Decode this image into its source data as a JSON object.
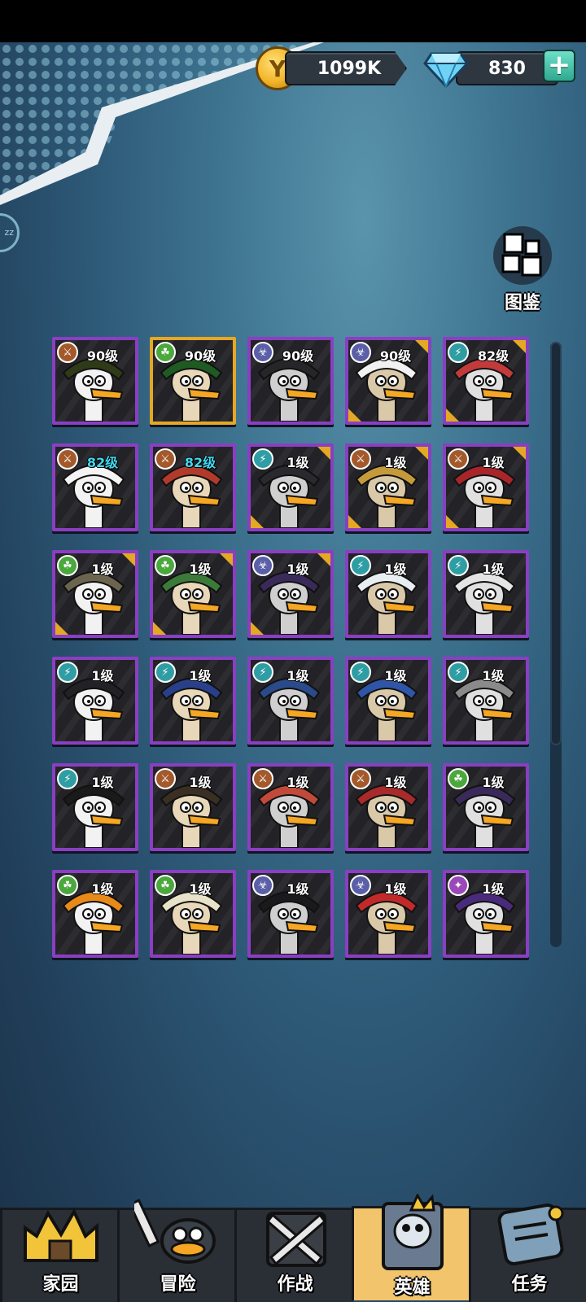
{
  "resources": {
    "coins": "1099K",
    "gems": "830",
    "add_label": "+"
  },
  "codex": {
    "label": "图鉴"
  },
  "heroes": [
    {
      "level": "90级",
      "class": "warrior",
      "frame": "purple",
      "level_color": "white",
      "portrait": "dreadlock-goose"
    },
    {
      "level": "90级",
      "class": "nature",
      "frame": "gold",
      "level_color": "white",
      "portrait": "spiky-green-goose"
    },
    {
      "level": "90级",
      "class": "toxic",
      "frame": "purple",
      "level_color": "white",
      "portrait": "dark-dragon-goose"
    },
    {
      "level": "90级",
      "class": "toxic",
      "frame": "gold-corner",
      "level_color": "white",
      "portrait": "white-hair-goose"
    },
    {
      "level": "82级",
      "class": "tech",
      "frame": "gold-corner",
      "level_color": "white",
      "portrait": "red-cap-goose"
    },
    {
      "level": "82级",
      "class": "warrior",
      "frame": "purple",
      "level_color": "cyan",
      "portrait": "witch-hat-goose"
    },
    {
      "level": "82级",
      "class": "warrior",
      "frame": "purple",
      "level_color": "cyan",
      "portrait": "samurai-goose"
    },
    {
      "level": "1级",
      "class": "tech",
      "frame": "gold-corner",
      "level_color": "white",
      "portrait": "suit-goose"
    },
    {
      "level": "1级",
      "class": "warrior",
      "frame": "gold-corner",
      "level_color": "white",
      "portrait": "gladiator-goose"
    },
    {
      "level": "1级",
      "class": "warrior",
      "frame": "gold-corner",
      "level_color": "white",
      "portrait": "red-hair-goose"
    },
    {
      "level": "1级",
      "class": "nature",
      "frame": "gold-corner",
      "level_color": "white",
      "portrait": "viking-goose"
    },
    {
      "level": "1级",
      "class": "nature",
      "frame": "gold-corner",
      "level_color": "white",
      "portrait": "army-helmet-goose"
    },
    {
      "level": "1级",
      "class": "toxic",
      "frame": "gold-corner",
      "level_color": "white",
      "portrait": "shadow-goose"
    },
    {
      "level": "1级",
      "class": "tech",
      "frame": "purple",
      "level_color": "white",
      "portrait": "mech-goose"
    },
    {
      "level": "1级",
      "class": "tech",
      "frame": "purple",
      "level_color": "white",
      "portrait": "goggles-goose"
    },
    {
      "level": "1级",
      "class": "tech",
      "frame": "purple",
      "level_color": "white",
      "portrait": "plain-goose"
    },
    {
      "level": "1级",
      "class": "tech",
      "frame": "purple",
      "level_color": "white",
      "portrait": "robot-goose"
    },
    {
      "level": "1级",
      "class": "tech",
      "frame": "purple",
      "level_color": "white",
      "portrait": "blue-helmet-goose"
    },
    {
      "level": "1级",
      "class": "tech",
      "frame": "purple",
      "level_color": "white",
      "portrait": "football-goose"
    },
    {
      "level": "1级",
      "class": "tech",
      "frame": "purple",
      "level_color": "white",
      "portrait": "glasses-goose"
    },
    {
      "level": "1级",
      "class": "tech",
      "frame": "purple",
      "level_color": "white",
      "portrait": "black-hair-goose"
    },
    {
      "level": "1级",
      "class": "warrior",
      "frame": "purple",
      "level_color": "white",
      "portrait": "straw-hat-goose"
    },
    {
      "level": "1级",
      "class": "warrior",
      "frame": "purple",
      "level_color": "white",
      "portrait": "fox-hood-goose"
    },
    {
      "level": "1级",
      "class": "warrior",
      "frame": "purple",
      "level_color": "white",
      "portrait": "red-mane-goose"
    },
    {
      "level": "1级",
      "class": "nature",
      "frame": "purple",
      "level_color": "white",
      "portrait": "pirate-goose"
    },
    {
      "level": "1级",
      "class": "nature",
      "frame": "purple",
      "level_color": "white",
      "portrait": "flame-hair-goose"
    },
    {
      "level": "1级",
      "class": "nature",
      "frame": "purple",
      "level_color": "white",
      "portrait": "turban-goose"
    },
    {
      "level": "1级",
      "class": "toxic",
      "frame": "purple",
      "level_color": "white",
      "portrait": "black-blob-goose"
    },
    {
      "level": "1级",
      "class": "toxic",
      "frame": "purple",
      "level_color": "white",
      "portrait": "red-mask-goose"
    },
    {
      "level": "1级",
      "class": "arcane",
      "frame": "purple",
      "level_color": "white",
      "portrait": "void-goose"
    }
  ],
  "nav": [
    {
      "label": "家园",
      "icon": "castle-icon",
      "active": false
    },
    {
      "label": "冒险",
      "icon": "sword-duck-icon",
      "active": false
    },
    {
      "label": "作战",
      "icon": "crossed-swords-icon",
      "active": false
    },
    {
      "label": "英雄",
      "icon": "hero-book-icon",
      "active": true
    },
    {
      "label": "任务",
      "icon": "scroll-icon",
      "active": false
    }
  ],
  "colors": {
    "frame_purple": "#8a3fc2",
    "frame_gold": "#e4a824",
    "level_cyan": "#43d8f0",
    "nav_active": "#f2c46b"
  }
}
